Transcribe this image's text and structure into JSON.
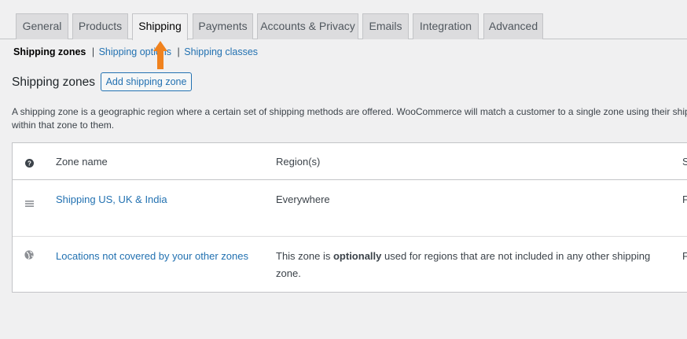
{
  "tabs": [
    {
      "label": "General"
    },
    {
      "label": "Products"
    },
    {
      "label": "Shipping"
    },
    {
      "label": "Payments"
    },
    {
      "label": "Accounts & Privacy"
    },
    {
      "label": "Emails"
    },
    {
      "label": "Integration"
    },
    {
      "label": "Advanced"
    }
  ],
  "active_tab": "Shipping",
  "subnav": {
    "current": "Shipping zones",
    "separator": "|",
    "options_link": "Shipping options",
    "separator2": "|",
    "classes_link": "Shipping classes"
  },
  "heading": {
    "title": "Shipping zones",
    "add_button": "Add shipping zone"
  },
  "description": {
    "line1": "A shipping zone is a geographic region where a certain set of shipping methods are offered. WooCommerce will match a customer to a single zone using their shipping",
    "line2": "within that zone to them."
  },
  "table": {
    "headers": {
      "name": "Zone name",
      "regions": "Region(s)",
      "methods_clipped": "S"
    },
    "rows": [
      {
        "name": "Shipping US, UK & India",
        "regions": "Everywhere",
        "methods_clipped": "F"
      },
      {
        "name": "Locations not covered by your other zones",
        "regions_pre": "This zone is ",
        "regions_bold": "optionally",
        "regions_post": " used for regions that are not included in any other shipping zone.",
        "methods_clipped": "F"
      }
    ]
  },
  "colors": {
    "link": "#2271b1",
    "arrow": "#f0821e",
    "background": "#f0f0f1",
    "tab_inactive": "#dcdcde"
  },
  "icons": {
    "help": "question-circle-icon",
    "drag": "drag-handle-icon",
    "globe": "globe-icon",
    "arrow": "up-arrow-icon"
  }
}
